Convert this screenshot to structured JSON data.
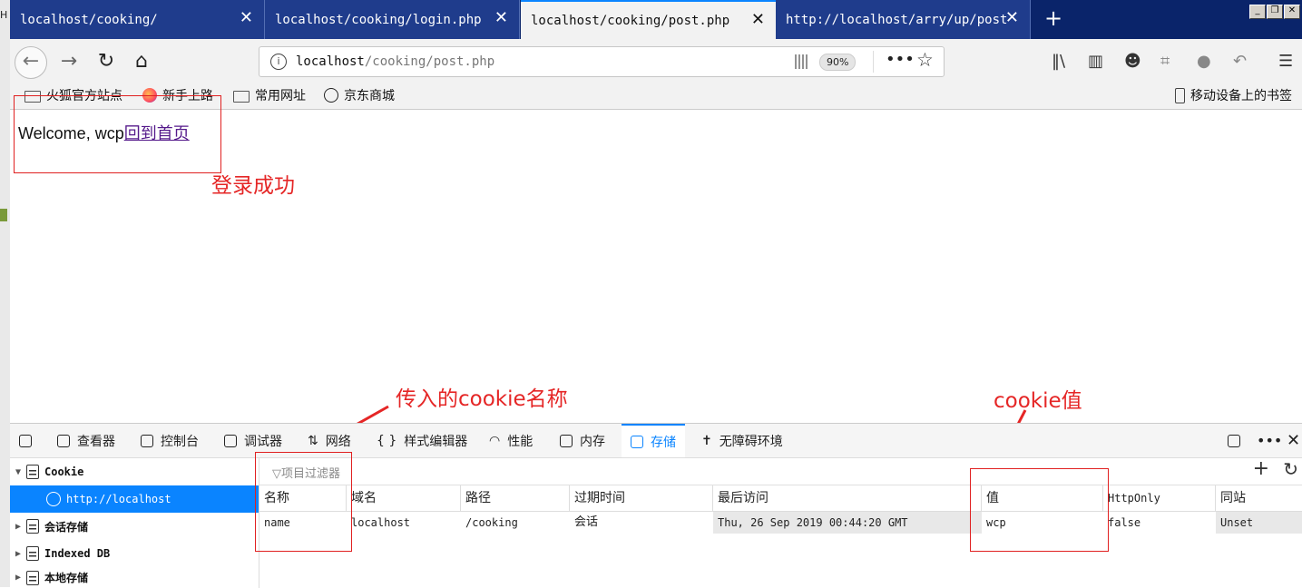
{
  "colors": {
    "tabbar": "#0a246a",
    "accent": "#0a84ff",
    "annotation": "#e52626",
    "link_visited": "#551a8b"
  },
  "tabs": [
    {
      "title": "localhost/cooking/",
      "active": false
    },
    {
      "title": "localhost/cooking/login.php",
      "active": false
    },
    {
      "title": "localhost/cooking/post.php",
      "active": true
    },
    {
      "title": "http://localhost/arry/up/post",
      "active": false
    }
  ],
  "tab_close_glyph": "✕",
  "navbar": {
    "url_host": "localhost",
    "url_path": "/cooking/post.php",
    "zoom": "90%",
    "icons": [
      "back-icon",
      "forward-icon",
      "reload-icon",
      "home-icon",
      "site-info-icon",
      "qr-code-icon",
      "more-icon",
      "bookmark-star-icon",
      "library-icon",
      "sidebar-icon",
      "account-icon",
      "screenshot-icon",
      "chat-icon",
      "undo-icon",
      "menu-icon"
    ]
  },
  "bookmarks": {
    "items": [
      "火狐官方站点",
      "新手上路",
      "常用网址",
      "京东商城"
    ],
    "mobile": "移动设备上的书签"
  },
  "page": {
    "welcome_text": "Welcome, wcp",
    "home_link": "回到首页"
  },
  "annotations": {
    "login_success": "登录成功",
    "cookie_name": "传入的cookie名称",
    "cookie_value": "cookie值"
  },
  "devtools": {
    "tabs": [
      "查看器",
      "控制台",
      "调试器",
      "网络",
      "样式编辑器",
      "性能",
      "内存",
      "存储",
      "无障碍环境"
    ],
    "active_tab": "存储",
    "tree": {
      "cookie": "Cookie",
      "cookie_host": "http://localhost",
      "session": "会话存储",
      "indexeddb": "Indexed DB",
      "local": "本地存储"
    },
    "filter_placeholder": "项目过滤器",
    "columns": [
      "名称",
      "域名",
      "路径",
      "过期时间",
      "最后访问",
      "值",
      "HttpOnly",
      "同站"
    ],
    "row": [
      "name",
      "localhost",
      "/cooking",
      "会话",
      "Thu, 26 Sep 2019 00:44:20 GMT",
      "wcp",
      "false",
      "Unset"
    ]
  }
}
